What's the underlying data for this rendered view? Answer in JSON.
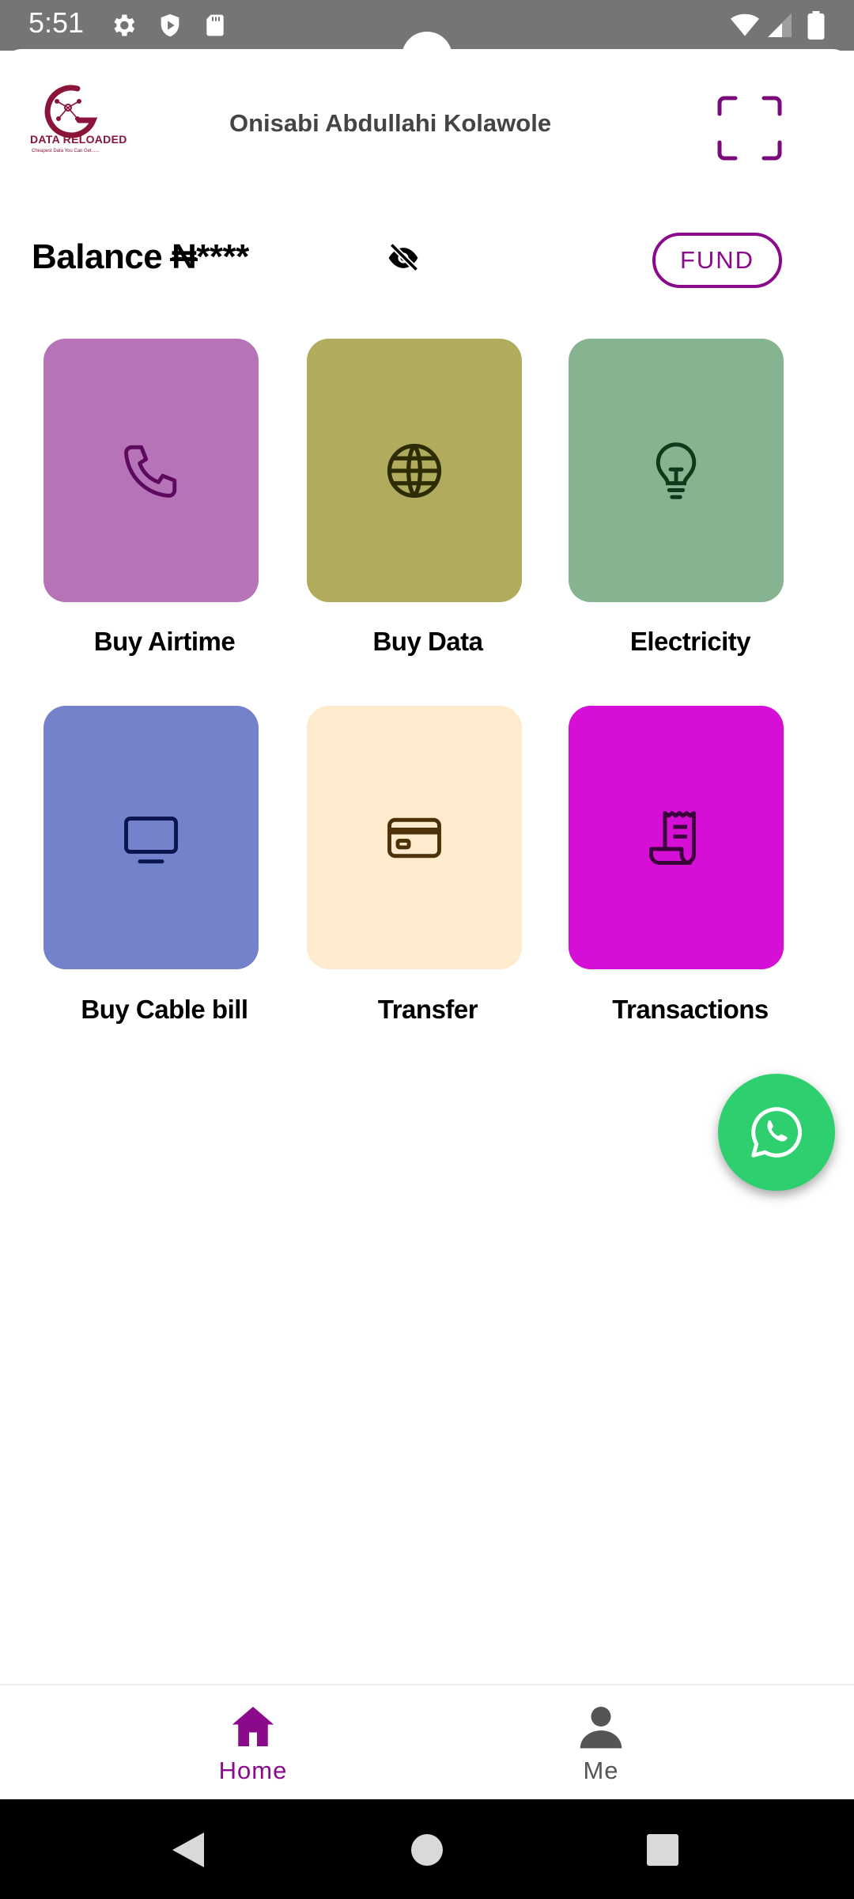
{
  "status_bar": {
    "time": "5:51",
    "icons": [
      "gear-icon",
      "shield-icon",
      "sd-card-icon",
      "wifi-icon",
      "signal-icon",
      "battery-icon"
    ]
  },
  "header": {
    "logo": {
      "brand": "DATA RELOADED",
      "tagline": "Cheapest Data You Can Get......"
    },
    "user_name": "Onisabi Abdullahi Kolawole",
    "scan_icon": "scan-frame-icon"
  },
  "balance": {
    "label": "Balance",
    "currency": "₦",
    "masked_amount": "****",
    "visibility_icon": "eye-off-icon",
    "fund_label": "FUND"
  },
  "services": [
    {
      "label": "Buy Airtime",
      "icon": "phone-icon",
      "color": "#b773b8",
      "icon_color": "#5d0a5e"
    },
    {
      "label": "Buy Data",
      "icon": "globe-icon",
      "color": "#b1ac5d",
      "icon_color": "#2e2c05"
    },
    {
      "label": "Electricity",
      "icon": "lightbulb-icon",
      "color": "#86b490",
      "icon_color": "#0d3a18"
    },
    {
      "label": "Buy Cable bill",
      "icon": "tv-icon",
      "color": "#7482cb",
      "icon_color": "#0b1650"
    },
    {
      "label": "Transfer",
      "icon": "credit-card-icon",
      "color": "#feebcd",
      "icon_color": "#4d3209"
    },
    {
      "label": "Transactions",
      "icon": "receipt-icon",
      "color": "#d60fd6",
      "icon_color": "#3a023a"
    }
  ],
  "fab": {
    "icon": "whatsapp-icon",
    "color": "#2ecf6f"
  },
  "bottom_nav": [
    {
      "label": "Home",
      "icon": "home-icon",
      "active": true,
      "color": "#8b0a8b"
    },
    {
      "label": "Me",
      "icon": "person-icon",
      "active": false,
      "color": "#555555"
    }
  ],
  "system_nav": [
    "back-icon",
    "home-circle-icon",
    "recents-icon"
  ]
}
